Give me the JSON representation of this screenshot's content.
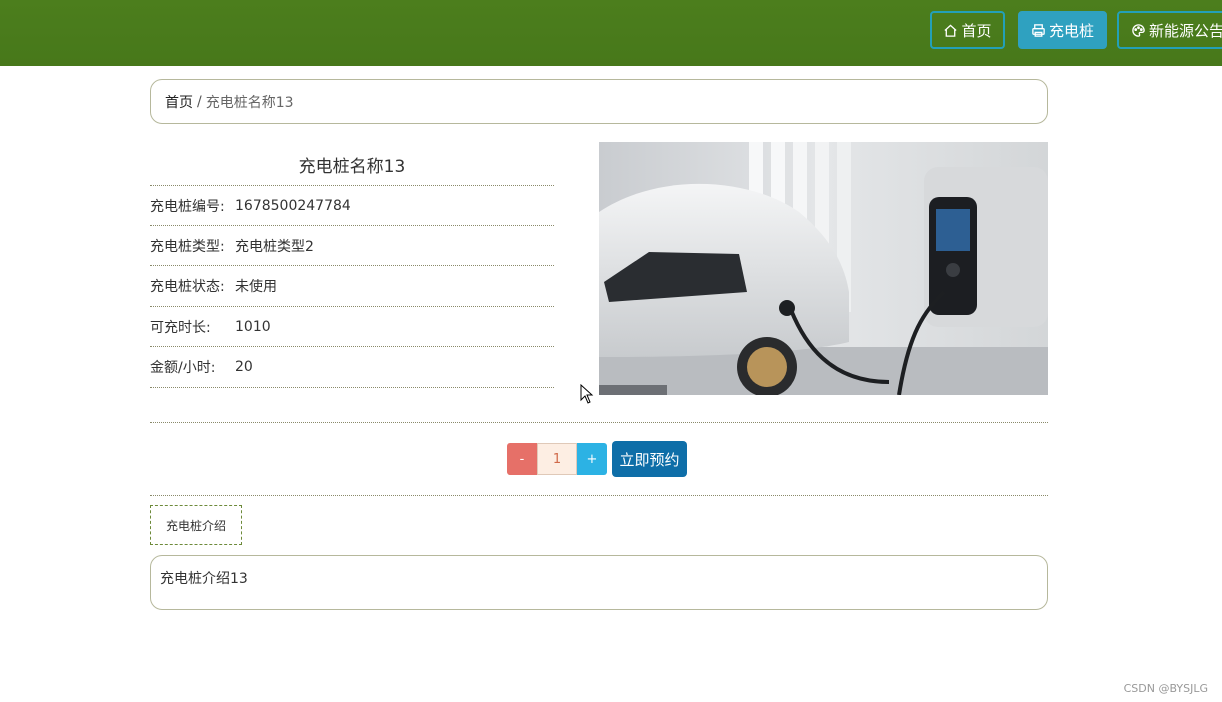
{
  "nav": {
    "home_label": "首页",
    "charger_label": "充电桩",
    "notice_label": "新能源公告"
  },
  "breadcrumb": {
    "home": "首页",
    "separator": "/",
    "current": "充电桩名称13"
  },
  "detail": {
    "title": "充电桩名称13",
    "fields": [
      {
        "label": "充电桩编号:",
        "value": "1678500247784"
      },
      {
        "label": "充电桩类型:",
        "value": "充电桩类型2"
      },
      {
        "label": "充电桩状态:",
        "value": "未使用"
      },
      {
        "label": "可充时长:",
        "value": "1010"
      },
      {
        "label": "金额/小时:",
        "value": "20"
      }
    ]
  },
  "quantity": {
    "minus": "-",
    "value": "1",
    "plus": "+"
  },
  "book_button": "立即预约",
  "tabs": [
    {
      "label": "充电桩介绍"
    }
  ],
  "intro": {
    "text": "充电桩介绍13"
  },
  "watermark": "CSDN @BYSJLG",
  "colors": {
    "topbar": "#4c7e1d",
    "nav_active": "#2fa1c0",
    "book_button": "#0e6ea8",
    "minus": "#e67068",
    "plus": "#2cb2e4"
  }
}
